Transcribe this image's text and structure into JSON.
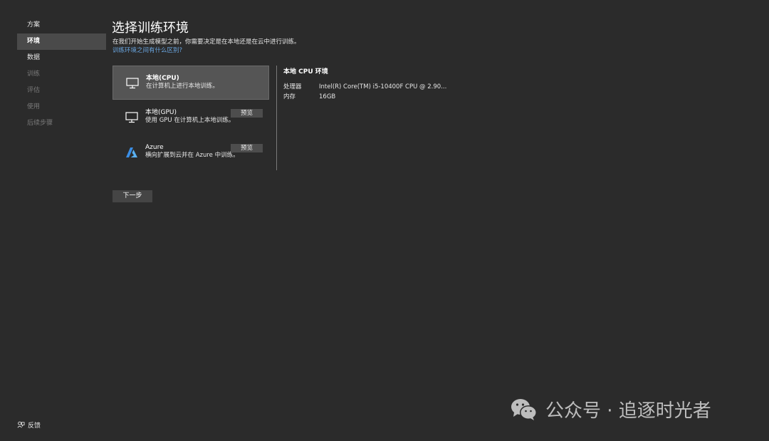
{
  "sidebar": {
    "items": [
      {
        "label": "方案",
        "state": "normal"
      },
      {
        "label": "环境",
        "state": "active"
      },
      {
        "label": "数据",
        "state": "normal"
      },
      {
        "label": "训练",
        "state": "disabled"
      },
      {
        "label": "评估",
        "state": "disabled"
      },
      {
        "label": "使用",
        "state": "disabled"
      },
      {
        "label": "后续步骤",
        "state": "disabled"
      }
    ],
    "feedback_label": "反馈"
  },
  "main": {
    "title": "选择训练环境",
    "subtitle": "在我们开始生成模型之前，你需要决定是在本地还是在云中进行训练。",
    "link": "训练环境之间有什么区别?",
    "options": [
      {
        "title": "本地(CPU)",
        "desc": "在计算机上进行本地训练。",
        "icon": "monitor-icon",
        "selected": true
      },
      {
        "title": "本地(GPU)",
        "desc": "使用 GPU 在计算机上本地训练。",
        "icon": "monitor-icon",
        "badge": "预览"
      },
      {
        "title": "Azure",
        "desc": "横向扩展到云并在 Azure 中训练。",
        "icon": "azure-icon",
        "badge": "预览"
      }
    ],
    "details": {
      "title": "本地 CPU 环境",
      "rows": [
        {
          "key": "处理器",
          "value": "Intel(R) Core(TM) i5-10400F CPU @ 2.90..."
        },
        {
          "key": "内存",
          "value": "16GB"
        }
      ]
    },
    "next_label": "下一步"
  },
  "watermark": {
    "text": "公众号 · 追逐时光者"
  },
  "colors": {
    "background": "#2b2b2b",
    "selected": "#555555",
    "link": "#6aa6e0",
    "azure": "#3a8ee6"
  }
}
